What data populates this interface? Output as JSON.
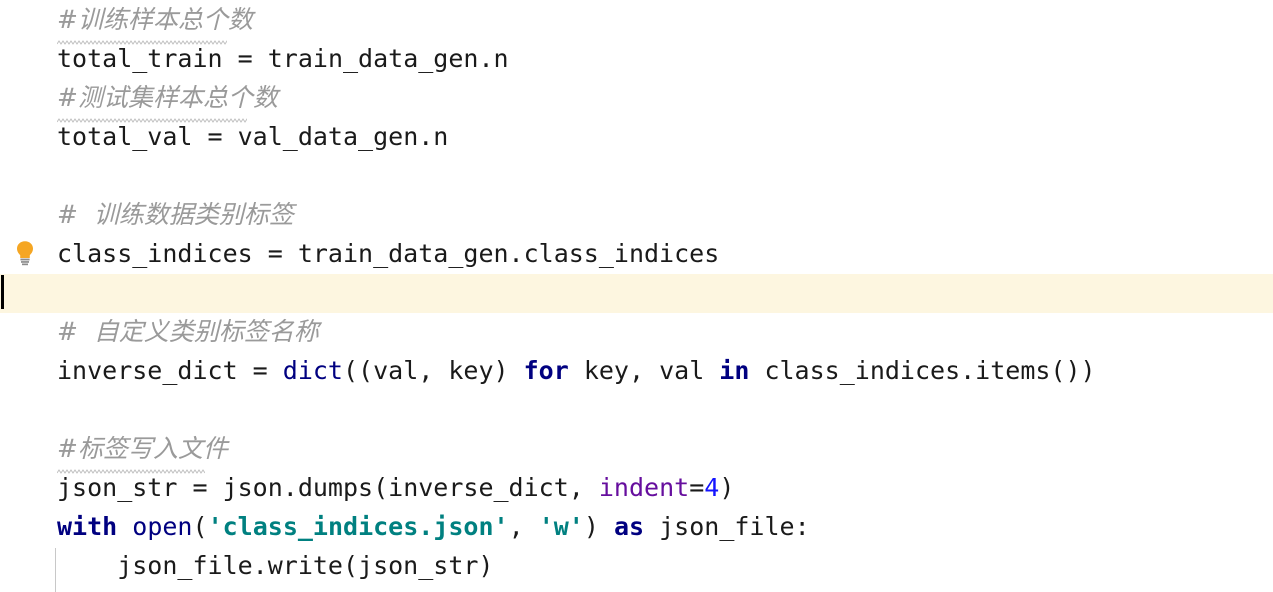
{
  "editor": {
    "name": "python-code-editor",
    "language": "Python",
    "font_size_px": 25,
    "line_height_px": 39,
    "colors": {
      "background": "#ffffff",
      "foreground": "#1a1a1a",
      "comment": "#9a9a9a",
      "keyword": "#000080",
      "builtin_function": "#000080",
      "string": "#008080",
      "number": "#1414ff",
      "named_argument": "#660e9e",
      "current_line_highlight": "#fdf6e0",
      "caret": "#000000",
      "indent_guide": "#c8c8c8",
      "squiggle": "#c0c0c0",
      "bulb_body": "#f5a623",
      "bulb_base": "#8c8c8c"
    },
    "caret": {
      "line_index": 7,
      "column": 0
    },
    "current_line_index": 7,
    "intention_bulb": {
      "icon": "lightbulb-icon",
      "attached_line_index": 6,
      "tooltip": ""
    },
    "lines": [
      {
        "index": 0,
        "indent": 0,
        "spellcheck_squiggle": true,
        "squiggle_width": 170,
        "tokens": [
          {
            "type": "comment",
            "text": "#训练样本总个数"
          }
        ]
      },
      {
        "index": 1,
        "indent": 0,
        "spellcheck_squiggle": false,
        "tokens": [
          {
            "type": "identifier",
            "text": "total_train "
          },
          {
            "type": "operator",
            "text": "= "
          },
          {
            "type": "identifier",
            "text": "train_data_gen.n"
          }
        ]
      },
      {
        "index": 2,
        "indent": 0,
        "spellcheck_squiggle": true,
        "squiggle_width": 190,
        "tokens": [
          {
            "type": "comment",
            "text": "#测试集样本总个数"
          }
        ]
      },
      {
        "index": 3,
        "indent": 0,
        "spellcheck_squiggle": false,
        "tokens": [
          {
            "type": "identifier",
            "text": "total_val "
          },
          {
            "type": "operator",
            "text": "= "
          },
          {
            "type": "identifier",
            "text": "val_data_gen.n"
          }
        ]
      },
      {
        "index": 4,
        "indent": 0,
        "spellcheck_squiggle": false,
        "tokens": []
      },
      {
        "index": 5,
        "indent": 0,
        "spellcheck_squiggle": false,
        "tokens": [
          {
            "type": "comment",
            "text": "#  训练数据类别标签"
          }
        ]
      },
      {
        "index": 6,
        "indent": 0,
        "spellcheck_squiggle": false,
        "tokens": [
          {
            "type": "identifier",
            "text": "class_indices "
          },
          {
            "type": "operator",
            "text": "= "
          },
          {
            "type": "identifier",
            "text": "train_data_gen.class_indices"
          }
        ]
      },
      {
        "index": 7,
        "indent": 0,
        "spellcheck_squiggle": false,
        "tokens": []
      },
      {
        "index": 8,
        "indent": 0,
        "spellcheck_squiggle": false,
        "tokens": [
          {
            "type": "comment",
            "text": "#  自定义类别标签名称"
          }
        ]
      },
      {
        "index": 9,
        "indent": 0,
        "spellcheck_squiggle": false,
        "tokens": [
          {
            "type": "identifier",
            "text": "inverse_dict "
          },
          {
            "type": "operator",
            "text": "= "
          },
          {
            "type": "builtin",
            "text": "dict"
          },
          {
            "type": "operator",
            "text": "((val, key) "
          },
          {
            "type": "keyword",
            "text": "for"
          },
          {
            "type": "operator",
            "text": " key, val "
          },
          {
            "type": "keyword",
            "text": "in"
          },
          {
            "type": "operator",
            "text": " class_indices.items())"
          }
        ]
      },
      {
        "index": 10,
        "indent": 0,
        "spellcheck_squiggle": false,
        "tokens": []
      },
      {
        "index": 11,
        "indent": 0,
        "spellcheck_squiggle": true,
        "squiggle_width": 148,
        "tokens": [
          {
            "type": "comment",
            "text": "#标签写入文件"
          }
        ]
      },
      {
        "index": 12,
        "indent": 0,
        "spellcheck_squiggle": false,
        "tokens": [
          {
            "type": "identifier",
            "text": "json_str "
          },
          {
            "type": "operator",
            "text": "= "
          },
          {
            "type": "identifier",
            "text": "json.dumps(inverse_dict, "
          },
          {
            "type": "kwarg",
            "text": "indent"
          },
          {
            "type": "operator",
            "text": "="
          },
          {
            "type": "number",
            "text": "4"
          },
          {
            "type": "operator",
            "text": ")"
          }
        ]
      },
      {
        "index": 13,
        "indent": 0,
        "spellcheck_squiggle": false,
        "tokens": [
          {
            "type": "keyword",
            "text": "with"
          },
          {
            "type": "operator",
            "text": " "
          },
          {
            "type": "builtin",
            "text": "open"
          },
          {
            "type": "operator",
            "text": "("
          },
          {
            "type": "string",
            "text": "'class_indices.json'"
          },
          {
            "type": "operator",
            "text": ", "
          },
          {
            "type": "string",
            "text": "'w'"
          },
          {
            "type": "operator",
            "text": ") "
          },
          {
            "type": "keyword",
            "text": "as"
          },
          {
            "type": "operator",
            "text": " json_file:"
          }
        ]
      },
      {
        "index": 14,
        "indent": 1,
        "spellcheck_squiggle": false,
        "tokens": [
          {
            "type": "identifier",
            "text": "    json_file.write(json_str)"
          }
        ]
      }
    ]
  }
}
